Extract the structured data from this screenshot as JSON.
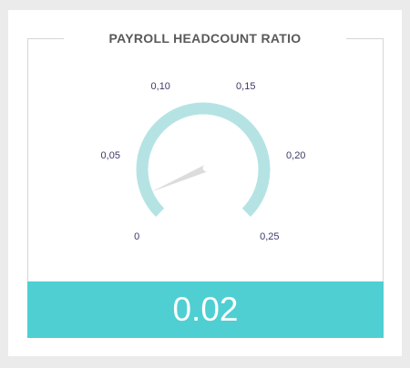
{
  "widget": {
    "title": "PAYROLL HEADCOUNT RATIO",
    "value_display": "0.02"
  },
  "colors": {
    "background": "#ebebeb",
    "card": "#ffffff",
    "arc": "#b5e3e4",
    "needle": "#dcdcdc",
    "tick_label": "#3b3b6a",
    "value_bar": "#4fcfd2",
    "value_text": "#ffffff",
    "title": "#595959",
    "frame": "#d6d6d6"
  },
  "chart_data": {
    "type": "gauge",
    "title": "PAYROLL HEADCOUNT RATIO",
    "min": 0,
    "max": 0.25,
    "value": 0.02,
    "ticks": [
      0,
      0.05,
      0.1,
      0.15,
      0.2,
      0.25
    ],
    "tick_labels": [
      "0",
      "0,05",
      "0,10",
      "0,15",
      "0,20",
      "0,25"
    ],
    "value_label": "0.02"
  }
}
